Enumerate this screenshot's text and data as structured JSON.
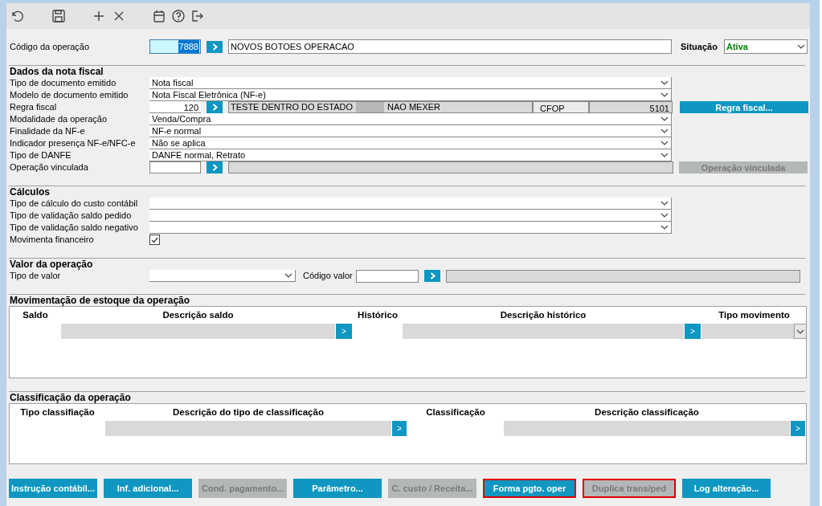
{
  "operation": {
    "label": "Código da operação",
    "code": "7888",
    "code_selected": true,
    "description": "NOVOS BOTOES OPERACAO",
    "status_label": "Situação",
    "status": "Ativa"
  },
  "nota_fiscal": {
    "title": "Dados da nota fiscal",
    "rows": [
      {
        "kind": "combo",
        "label": "Tipo de documento emitido",
        "value": "Nota fiscal"
      },
      {
        "kind": "combo",
        "label": "Modelo de documento emitido",
        "value": "Nota Fiscal Eletrônica (NF-e)"
      },
      {
        "kind": "rule",
        "label": "Regra fiscal",
        "code": "120",
        "description": [
          "TESTE DENTRO DO ESTADO",
          "NAO MEXER"
        ],
        "cfop_label": "CFOP",
        "cfop": "5101",
        "button": {
          "label": "Regra fiscal...",
          "disabled": false
        }
      },
      {
        "kind": "combo",
        "label": "Modalidade da operação",
        "value": "Venda/Compra"
      },
      {
        "kind": "combo",
        "label": "Finalidade da NF-e",
        "value": "NF-e normal"
      },
      {
        "kind": "combo",
        "label": "Indicador presença NF-e/NFC-e",
        "value": "Não se aplica"
      },
      {
        "kind": "combo",
        "label": "Tipo de DANFE",
        "value": "DANFE normal, Retrato"
      },
      {
        "kind": "lookup",
        "label": "Operação vinculada",
        "button": {
          "label": "Operação vinculada",
          "disabled": true
        }
      }
    ]
  },
  "calculos": {
    "title": "Cálculos",
    "rows": [
      {
        "kind": "combo",
        "label": "Tipo de cálculo do custo contábil"
      },
      {
        "kind": "combo",
        "label": "Tipo de validação saldo pedido"
      },
      {
        "kind": "combo",
        "label": "Tipo de validação saldo negativo"
      },
      {
        "kind": "checkbox",
        "label": "Movimenta financeiro",
        "checked": true
      }
    ]
  },
  "valor": {
    "title": "Valor da operação",
    "type_label": "Tipo de valor",
    "code_label": "Código valor"
  },
  "estoque": {
    "title": "Movimentação de estoque da operação",
    "columns": [
      {
        "label": "Saldo",
        "kind": "plain"
      },
      {
        "label": "Descrição saldo",
        "kind": "lookup"
      },
      {
        "kind": "button",
        "button": ">"
      },
      {
        "label": "Histórico",
        "kind": "plain"
      },
      {
        "label": "Descrição histórico",
        "kind": "lookup"
      },
      {
        "kind": "button",
        "button": ">"
      },
      {
        "label": "Tipo movimento",
        "kind": "select"
      }
    ]
  },
  "classificacao": {
    "title": "Classificação da operação",
    "columns": [
      {
        "label": "Tipo classifiação",
        "kind": "plain"
      },
      {
        "label": "Descrição do tipo de classificação",
        "kind": "lookup"
      },
      {
        "kind": "button",
        "button": ">"
      },
      {
        "label": "Classificação",
        "kind": "plain"
      },
      {
        "label": "Descrição classificação",
        "kind": "lookup"
      },
      {
        "kind": "button",
        "button": ">"
      }
    ]
  },
  "buttons": [
    {
      "label": "Instrução contábil...",
      "disabled": false,
      "highlighted": false
    },
    {
      "label": "Inf. adicional...",
      "disabled": false,
      "highlighted": false
    },
    {
      "label": "Cond. pagamento...",
      "disabled": true,
      "highlighted": false
    },
    {
      "label": "Parâmetro...",
      "disabled": false,
      "highlighted": false
    },
    {
      "label": "C. custo / Receita...",
      "disabled": true,
      "highlighted": false
    },
    {
      "label": "Forma pgto. oper",
      "disabled": false,
      "highlighted": true
    },
    {
      "label": "Duplica trans/ped",
      "disabled": true,
      "highlighted": true
    },
    {
      "label": "Log alteração...",
      "disabled": false,
      "highlighted": false
    }
  ]
}
